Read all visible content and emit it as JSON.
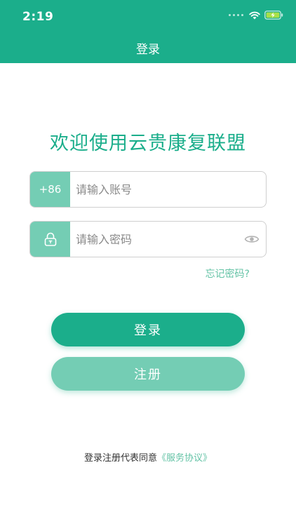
{
  "status_bar": {
    "time": "2:19"
  },
  "nav": {
    "title": "登录"
  },
  "welcome": {
    "title": "欢迎使用云贵康复联盟"
  },
  "form": {
    "phone": {
      "prefix": "+86",
      "placeholder": "请输入账号",
      "value": ""
    },
    "password": {
      "placeholder": "请输入密码",
      "value": ""
    },
    "forgot_label": "忘记密码?"
  },
  "buttons": {
    "login_label": "登录",
    "register_label": "注册"
  },
  "agreement": {
    "text": "登录注册代表同意",
    "link": "《服务协议》"
  },
  "icons": {
    "status": [
      "signal-dots-icon",
      "wifi-icon",
      "battery-charging-icon"
    ],
    "password_prefix": "lock-icon",
    "password_toggle": "eye-icon"
  },
  "colors": {
    "primary": "#1bae8b",
    "primary_light": "#74cdb4",
    "link": "#64c3a6",
    "battery": "#a8e04a"
  }
}
